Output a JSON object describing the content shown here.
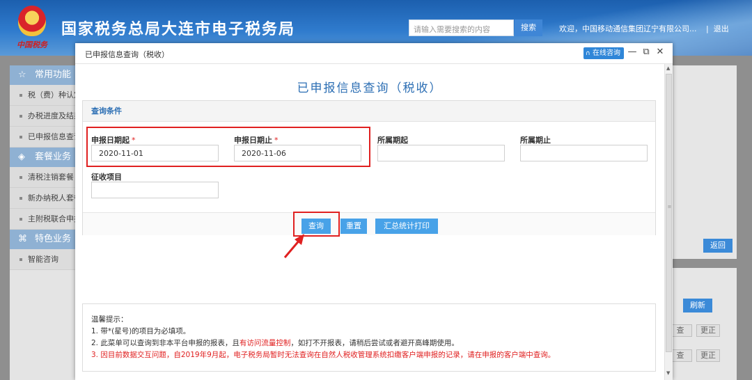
{
  "header": {
    "emblem_text": "中国税务",
    "site_title": "国家税务总局大连市电子税务局",
    "search_placeholder": "请输入需要搜索的内容",
    "search_button": "搜索",
    "welcome": "欢迎，中国移动通信集团辽宁有限公司...",
    "separator": "|",
    "logout": "退出"
  },
  "sidebar": {
    "groups": [
      {
        "icon": "☆",
        "label": "常用功能",
        "items": [
          "税（费）种认定",
          "办税进度及结果",
          "已申报信息查询"
        ]
      },
      {
        "icon": "◈",
        "label": "套餐业务",
        "items": [
          "清税注销套餐",
          "新办纳税人套餐",
          "主附税联合申报"
        ]
      },
      {
        "icon": "⌘",
        "label": "特色业务",
        "items": [
          "智能咨询"
        ]
      }
    ]
  },
  "background": {
    "return_button": "返回",
    "refresh_button": "刷新",
    "small_buttons": [
      "查",
      "更正",
      "查",
      "更正"
    ]
  },
  "modal": {
    "title": "已申报信息查询（税收）",
    "online_consult": "在线咨询",
    "controls": {
      "minimize": "—",
      "restore": "⧉",
      "close": "✕"
    },
    "heading": "已申报信息查询（税收）",
    "query": {
      "header": "查询条件",
      "fields": {
        "date_start": {
          "label": "申报日期起",
          "required": "*",
          "value": "2020-11-01"
        },
        "date_end": {
          "label": "申报日期止",
          "required": "*",
          "value": "2020-11-06"
        },
        "period_start": {
          "label": "所属期起",
          "value": ""
        },
        "period_end": {
          "label": "所属期止",
          "value": ""
        },
        "levy_item": {
          "label": "征收项目",
          "value": ""
        }
      },
      "buttons": {
        "query": "查询",
        "reset": "重置",
        "summary_print": "汇总统计打印"
      }
    },
    "tips": {
      "title": "温馨提示：",
      "line1": "1. 带*(星号)的项目为必填项。",
      "line2_a": "2. 此菜单可以查询到非本平台申报的报表，且",
      "line2_red": "有访问流量控制",
      "line2_b": "，如打不开报表，请稍后尝试或者避开高峰期使用。",
      "line3": "3. 因目前数据交互问题，自2019年9月起，电子税务局暂时无法查询在自然人税收管理系统扣缴客户端申报的记录，请在申报的客户端中查询。"
    }
  }
}
